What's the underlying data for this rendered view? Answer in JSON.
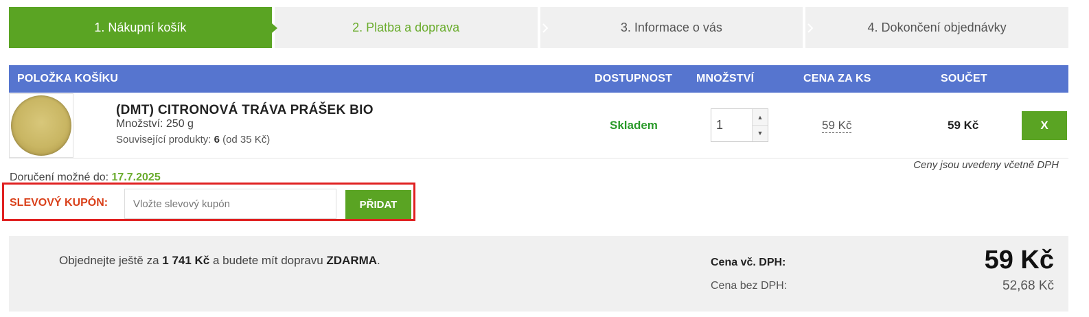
{
  "steps": [
    {
      "label": "1. Nákupní košík"
    },
    {
      "label": "2. Platba a doprava"
    },
    {
      "label": "3. Informace o vás"
    },
    {
      "label": "4. Dokončení objednávky"
    }
  ],
  "table": {
    "headers": {
      "item": "POLOŽKA KOŠÍKU",
      "availability": "DOSTUPNOST",
      "quantity": "MNOŽSTVÍ",
      "unit_price": "CENA ZA KS",
      "total": "SOUČET"
    }
  },
  "product": {
    "title": "(DMT) CITRONOVÁ TRÁVA PRÁŠEK BIO",
    "amount": "Množství: 250 g",
    "related_prefix": "Související produkty: ",
    "related_count": "6",
    "related_suffix": " (od 35 Kč)",
    "availability": "Skladem",
    "quantity": "1",
    "unit_price": "59 Kč",
    "total": "59 Kč",
    "remove_label": "X"
  },
  "vat_note": "Ceny jsou uvedeny včetně DPH",
  "delivery": {
    "label": "Doručení možné do: ",
    "date": "17.7.2025"
  },
  "coupon": {
    "label": "SLEVOVÝ KUPÓN:",
    "placeholder": "Vložte slevový kupón",
    "button": "PŘIDAT"
  },
  "summary": {
    "free_shipping_prefix": "Objednejte ještě za ",
    "free_shipping_amount": "1 741 Kč",
    "free_shipping_middle": " a budete mít dopravu ",
    "free_shipping_word": "ZDARMA",
    "free_shipping_suffix": ".",
    "price_with_vat_label": "Cena vč. DPH:",
    "price_with_vat": "59 Kč",
    "price_without_vat_label": "Cena bez DPH:",
    "price_without_vat": "52,68 Kč"
  },
  "colors": {
    "accent_green": "#5aa423",
    "header_blue": "#5675cf",
    "stock_green": "#2a9a2a",
    "coupon_red": "#e02020"
  }
}
